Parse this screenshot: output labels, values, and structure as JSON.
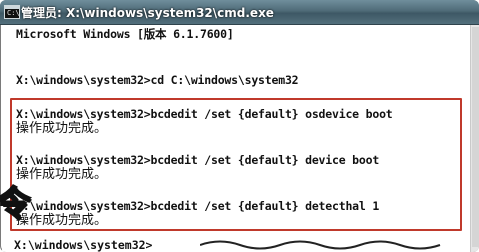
{
  "window": {
    "title": "管理员: X:\\windows\\system32\\cmd.exe",
    "icon_text": "C:\\"
  },
  "console": {
    "lines": [
      "Microsoft Windows [版本 6.1.7600]",
      "X:\\windows\\system32>cd C:\\windows\\system32",
      "X:\\windows\\system32>bcdedit /set {default} osdevice boot",
      "操作成功完成。",
      "X:\\windows\\system32>bcdedit /set {default} device boot",
      "操作成功完成。",
      "X:\\windows\\system32>bcdedit /set {default} detecthal 1",
      "操作成功完成。",
      "X:\\windows\\system32>"
    ]
  },
  "overlay": {
    "text": "令"
  },
  "colors": {
    "highlight_border": "#c0392b",
    "console_bg": "#ffffff",
    "console_text": "#111111"
  }
}
